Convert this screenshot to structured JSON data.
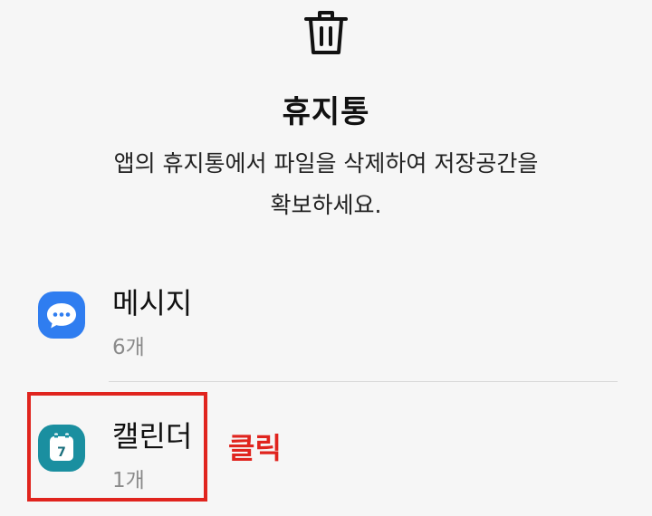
{
  "header": {
    "icon": "trash-icon",
    "title": "휴지통",
    "description_line1": "앱의 휴지통에서 파일을 삭제하여 저장공간을",
    "description_line2": "확보하세요."
  },
  "items": [
    {
      "name": "메시지",
      "count": "6개",
      "icon": "messages-icon",
      "icon_color": "#2f7df0"
    },
    {
      "name": "캘린더",
      "count": "1개",
      "icon": "calendar-icon",
      "icon_color": "#1a8fa0",
      "calendar_day": "7"
    }
  ],
  "annotation": {
    "label": "클릭",
    "color": "#e0241e"
  }
}
